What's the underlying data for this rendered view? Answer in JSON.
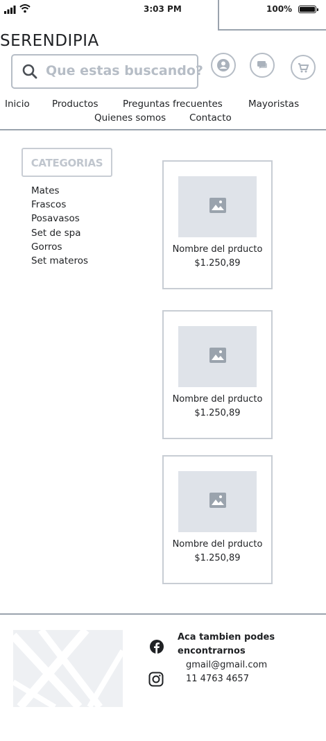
{
  "status_bar": {
    "time": "3:03 PM",
    "battery": "100%"
  },
  "brand": {
    "logo": "SERENDIPIA"
  },
  "search": {
    "placeholder": "Que estas buscando?"
  },
  "header_icons": [
    "user-icon",
    "chat-icon",
    "cart-icon"
  ],
  "nav": {
    "items": [
      "Inicio",
      "Productos",
      "Preguntas frecuentes",
      "Mayoristas",
      "Quienes somos",
      "Contacto"
    ]
  },
  "sidebar": {
    "categories_label": "CATEGORIAS",
    "categories": [
      "Mates",
      "Frascos",
      "Posavasos",
      "Set de spa",
      "Gorros",
      "Set materos"
    ]
  },
  "products": [
    {
      "name": "Nombre del prducto",
      "price": "$1.250,89"
    },
    {
      "name": "Nombre del prducto",
      "price": "$1.250,89"
    },
    {
      "name": "Nombre del prducto",
      "price": "$1.250,89"
    }
  ],
  "footer": {
    "title": "Aca tambien podes encontrarnos",
    "email": "gmail@gmail.com",
    "phone": "11 4763 4657",
    "social_icons": [
      "facebook-icon",
      "instagram-icon"
    ]
  },
  "colors": {
    "border": "#b6bdc6",
    "placeholder_fill": "#dfe3e9",
    "divider": "#9aa3ad",
    "text": "#1f2124"
  }
}
